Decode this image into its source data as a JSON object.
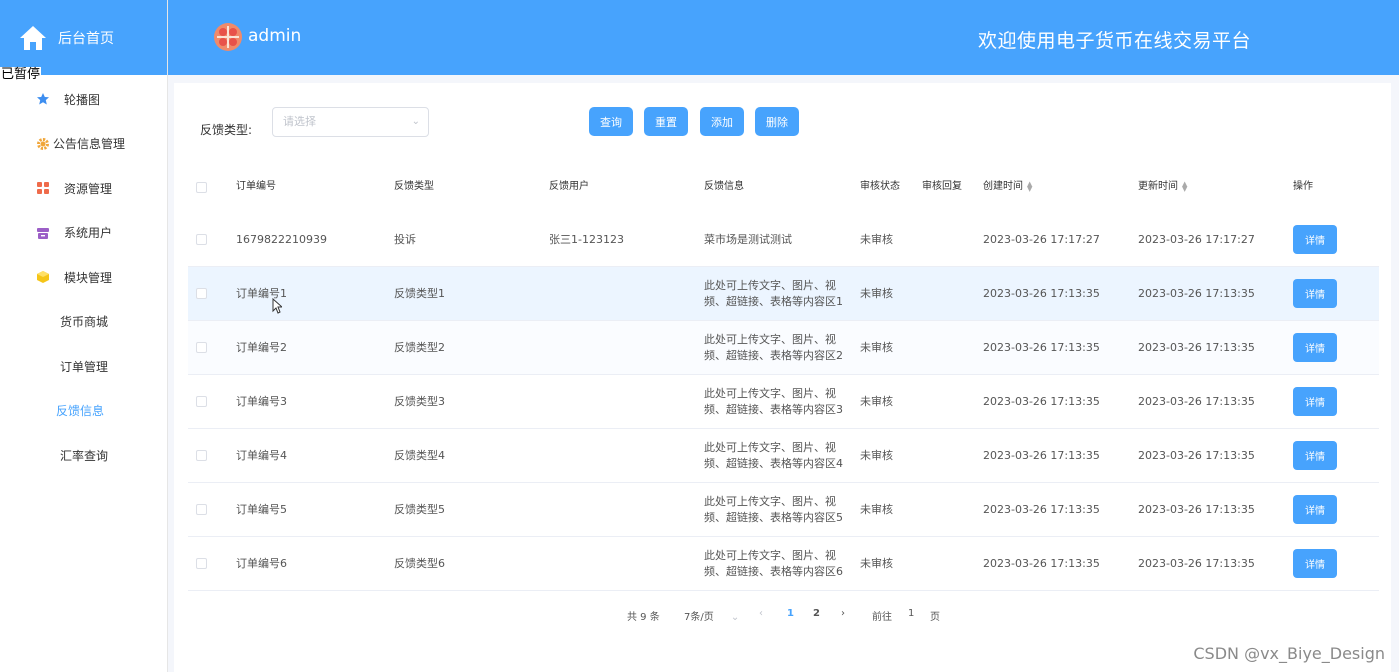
{
  "sidebar": {
    "brand_label": "后台首页",
    "paused_label": "已暂停",
    "items": [
      {
        "label": "轮播图",
        "icon": "star-icon"
      },
      {
        "label": "公告信息管理",
        "icon": "gear-icon"
      },
      {
        "label": "资源管理",
        "icon": "grid-icon"
      },
      {
        "label": "系统用户",
        "icon": "archive-icon"
      },
      {
        "label": "模块管理",
        "icon": "cube-icon"
      },
      {
        "label": "货币商城"
      },
      {
        "label": "订单管理"
      },
      {
        "label": "反馈信息",
        "active": true
      },
      {
        "label": "汇率查询"
      }
    ]
  },
  "header": {
    "username": "admin",
    "site_title": "欢迎使用电子货币在线交易平台"
  },
  "filter": {
    "label": "反馈类型:",
    "placeholder": "请选择",
    "buttons": {
      "query": "查询",
      "reset": "重置",
      "add": "添加",
      "delete": "删除"
    }
  },
  "table": {
    "columns": {
      "order_no": "订单编号",
      "type": "反馈类型",
      "user": "反馈用户",
      "info": "反馈信息",
      "status": "审核状态",
      "reply": "审核回复",
      "created": "创建时间",
      "updated": "更新时间",
      "op": "操作"
    },
    "detail_label": "详情",
    "rows": [
      {
        "order_no": "1679822210939",
        "type": "投诉",
        "user": "张三1-123123",
        "info": "菜市场是测试测试",
        "status": "未审核",
        "reply": "",
        "created": "2023-03-26 17:17:27",
        "updated": "2023-03-26 17:17:27"
      },
      {
        "order_no": "订单编号1",
        "type": "反馈类型1",
        "user": "",
        "info": "此处可上传文字、图片、视频、超链接、表格等内容区1",
        "status": "未审核",
        "reply": "",
        "created": "2023-03-26 17:13:35",
        "updated": "2023-03-26 17:13:35"
      },
      {
        "order_no": "订单编号2",
        "type": "反馈类型2",
        "user": "",
        "info": "此处可上传文字、图片、视频、超链接、表格等内容区2",
        "status": "未审核",
        "reply": "",
        "created": "2023-03-26 17:13:35",
        "updated": "2023-03-26 17:13:35"
      },
      {
        "order_no": "订单编号3",
        "type": "反馈类型3",
        "user": "",
        "info": "此处可上传文字、图片、视频、超链接、表格等内容区3",
        "status": "未审核",
        "reply": "",
        "created": "2023-03-26 17:13:35",
        "updated": "2023-03-26 17:13:35"
      },
      {
        "order_no": "订单编号4",
        "type": "反馈类型4",
        "user": "",
        "info": "此处可上传文字、图片、视频、超链接、表格等内容区4",
        "status": "未审核",
        "reply": "",
        "created": "2023-03-26 17:13:35",
        "updated": "2023-03-26 17:13:35"
      },
      {
        "order_no": "订单编号5",
        "type": "反馈类型5",
        "user": "",
        "info": "此处可上传文字、图片、视频、超链接、表格等内容区5",
        "status": "未审核",
        "reply": "",
        "created": "2023-03-26 17:13:35",
        "updated": "2023-03-26 17:13:35"
      },
      {
        "order_no": "订单编号6",
        "type": "反馈类型6",
        "user": "",
        "info": "此处可上传文字、图片、视频、超链接、表格等内容区6",
        "status": "未审核",
        "reply": "",
        "created": "2023-03-26 17:13:35",
        "updated": "2023-03-26 17:13:35"
      }
    ]
  },
  "pagination": {
    "total": "共 9 条",
    "page_size": "7条/页",
    "pages": [
      "1",
      "2"
    ],
    "current_page": "1",
    "goto_label": "前往",
    "goto_value": "1",
    "page_unit": "页"
  },
  "watermark": "CSDN @vx_Biye_Design",
  "colors": {
    "primary": "#47a3fd",
    "hover_row": "#ecf5ff"
  }
}
